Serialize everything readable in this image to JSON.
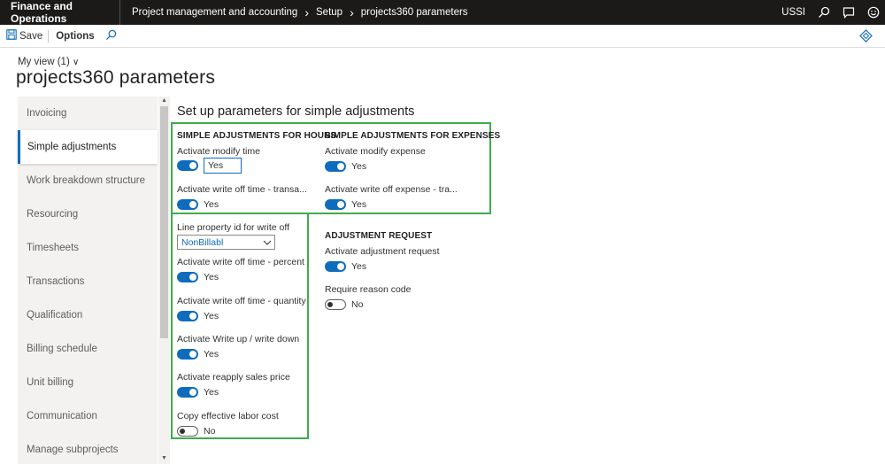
{
  "topbar": {
    "app_name": "Finance and Operations",
    "breadcrumb": [
      "Project management and accounting",
      "Setup",
      "projects360 parameters"
    ],
    "company": "USSI",
    "icons": [
      "search-icon",
      "chat-icon",
      "smiley-icon"
    ]
  },
  "actionbar": {
    "save_label": "Save",
    "options_label": "Options"
  },
  "header": {
    "my_view": "My view (1)",
    "page_title": "projects360 parameters"
  },
  "sidebar": {
    "items": [
      {
        "label": "Invoicing",
        "active": false
      },
      {
        "label": "Simple adjustments",
        "active": true
      },
      {
        "label": "Work breakdown structure",
        "active": false
      },
      {
        "label": "Resourcing",
        "active": false
      },
      {
        "label": "Timesheets",
        "active": false
      },
      {
        "label": "Transactions",
        "active": false
      },
      {
        "label": "Qualification",
        "active": false
      },
      {
        "label": "Billing schedule",
        "active": false
      },
      {
        "label": "Unit billing",
        "active": false
      },
      {
        "label": "Communication",
        "active": false
      },
      {
        "label": "Manage subprojects",
        "active": false
      }
    ]
  },
  "content": {
    "section_title": "Set up parameters for simple adjustments",
    "hours": {
      "heading": "SIMPLE ADJUSTMENTS FOR HOURS",
      "modify_time_label": "Activate modify time",
      "modify_time_value": "Yes",
      "write_off_trans_label": "Activate write off time - transa...",
      "write_off_trans_value": "Yes",
      "line_property_label": "Line property id for write off",
      "line_property_value": "NonBillabl",
      "write_off_percent_label": "Activate write off time - percent",
      "write_off_percent_value": "Yes",
      "write_off_qty_label": "Activate write off time - quantity",
      "write_off_qty_value": "Yes",
      "write_up_label": "Activate Write up / write down",
      "write_up_value": "Yes",
      "reapply_price_label": "Activate reapply sales price",
      "reapply_price_value": "Yes",
      "copy_labor_label": "Copy effective labor cost",
      "copy_labor_value": "No"
    },
    "expenses": {
      "heading": "SIMPLE ADJUSTMENTS FOR EXPENSES",
      "modify_expense_label": "Activate modify expense",
      "modify_expense_value": "Yes",
      "write_off_expense_label": "Activate write off expense - tra...",
      "write_off_expense_value": "Yes"
    },
    "adjustment": {
      "heading": "ADJUSTMENT REQUEST",
      "activate_label": "Activate adjustment request",
      "activate_value": "Yes",
      "reason_label": "Require reason code",
      "reason_value": "No"
    }
  },
  "colors": {
    "accent": "#0f6cbd",
    "highlight_box": "#3fab4b",
    "topbar": "#1b1a19"
  }
}
